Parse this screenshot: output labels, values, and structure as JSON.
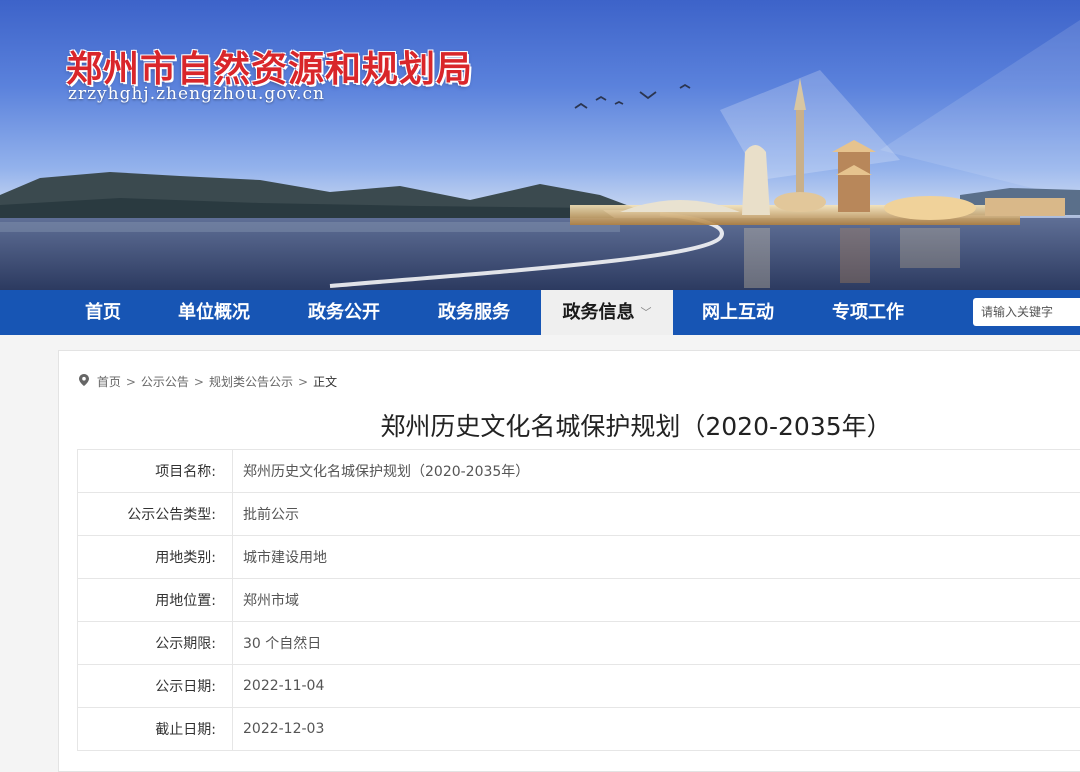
{
  "header": {
    "site_title": "郑州市自然资源和规划局",
    "site_url": "zrzyhghj.zhengzhou.gov.cn"
  },
  "nav": {
    "items": [
      {
        "label": "首页"
      },
      {
        "label": "单位概况"
      },
      {
        "label": "政务公开"
      },
      {
        "label": "政务服务"
      },
      {
        "label": "政务信息",
        "active": true
      },
      {
        "label": "网上互动"
      },
      {
        "label": "专项工作"
      }
    ],
    "search_placeholder": "请输入关键字"
  },
  "breadcrumb": [
    "首页",
    "公示公告",
    "规划类公告公示",
    "正文"
  ],
  "document": {
    "title": "郑州历史文化名城保护规划（2020-2035年）",
    "fields": [
      {
        "label": "项目名称:",
        "value": "郑州历史文化名城保护规划（2020-2035年）"
      },
      {
        "label": "公示公告类型:",
        "value": "批前公示"
      },
      {
        "label": "用地类别:",
        "value": "城市建设用地"
      },
      {
        "label": "用地位置:",
        "value": "郑州市域"
      },
      {
        "label": "公示期限:",
        "value": "30 个自然日"
      },
      {
        "label": "公示日期:",
        "value": "2022-11-04"
      },
      {
        "label": "截止日期:",
        "value": "2022-12-03"
      }
    ]
  },
  "colors": {
    "nav_bg": "#1755b4",
    "title_red": "#d9262a"
  }
}
